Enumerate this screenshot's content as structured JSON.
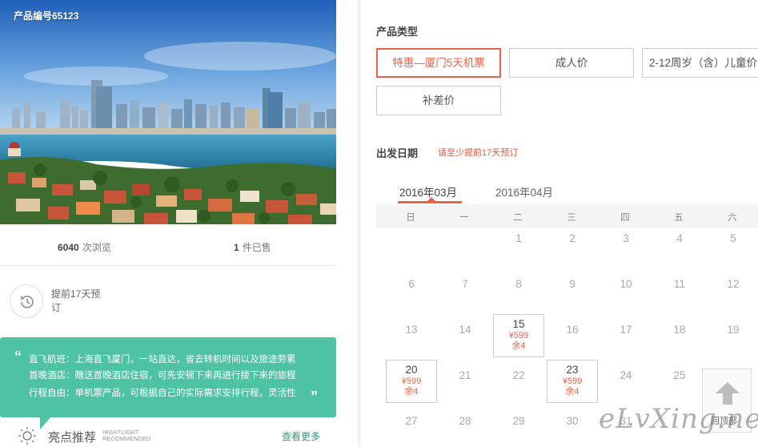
{
  "product": {
    "number_label": "产品编号65123"
  },
  "stats": {
    "views_count": "6040",
    "views_label": "次浏览",
    "sold_count": "1",
    "sold_label": "件已售"
  },
  "advance": {
    "text": "提前17天预订"
  },
  "promo": {
    "line1": "直飞航班：上海直飞厦门，一站直达，省去转机时间以及旅途劳累",
    "line2": "首晚酒店：赠送首晚酒店住宿，可先安顿下来再进行接下来的旅程",
    "line3": "行程自由：单机票产品，可根据自己的实际需求安排行程，灵活性"
  },
  "highlight": {
    "title": "亮点推荐",
    "en_line1": "HIGHTLIGHT",
    "en_line2": "RECOMMENDED",
    "more": "查看更多"
  },
  "product_type": {
    "label": "产品类型",
    "options": [
      {
        "label": "特惠—厦门5天机票",
        "active": true
      },
      {
        "label": "成人价",
        "active": false
      },
      {
        "label": "2-12周岁（含）儿童价",
        "active": false
      },
      {
        "label": "补差价",
        "active": false
      }
    ]
  },
  "departure": {
    "label": "出发日期",
    "hint": "请至少提前17天预订"
  },
  "calendar": {
    "months": [
      "2016年03月",
      "2016年04月"
    ],
    "active_month": 0,
    "weekdays": [
      "日",
      "一",
      "二",
      "三",
      "四",
      "五",
      "六"
    ],
    "rows": [
      [
        {
          "d": ""
        },
        {
          "d": ""
        },
        {
          "d": "1"
        },
        {
          "d": "2"
        },
        {
          "d": "3"
        },
        {
          "d": "4"
        },
        {
          "d": "5"
        }
      ],
      [
        {
          "d": "6"
        },
        {
          "d": "7"
        },
        {
          "d": "8"
        },
        {
          "d": "9"
        },
        {
          "d": "10"
        },
        {
          "d": "11"
        },
        {
          "d": "12"
        }
      ],
      [
        {
          "d": "13"
        },
        {
          "d": "14"
        },
        {
          "d": "15",
          "price": "¥599",
          "left": "余4"
        },
        {
          "d": "16"
        },
        {
          "d": "17"
        },
        {
          "d": "18"
        },
        {
          "d": "19"
        }
      ],
      [
        {
          "d": "20",
          "price": "¥599",
          "left": "余4"
        },
        {
          "d": "21"
        },
        {
          "d": "22"
        },
        {
          "d": "23",
          "price": "¥599",
          "left": "余4"
        },
        {
          "d": "24"
        },
        {
          "d": "25"
        },
        {
          "d": ""
        }
      ],
      [
        {
          "d": "27"
        },
        {
          "d": "28"
        },
        {
          "d": "29"
        },
        {
          "d": "30"
        },
        {
          "d": "31"
        },
        {
          "d": ""
        },
        {
          "d": ""
        }
      ]
    ]
  },
  "back_top": {
    "label": "回顶部"
  },
  "watermark": {
    "text": "eLvXing.net"
  },
  "colors": {
    "accent": "#e9634a",
    "promo_bg": "#4ec3a4",
    "more_link": "#2f9c72"
  }
}
